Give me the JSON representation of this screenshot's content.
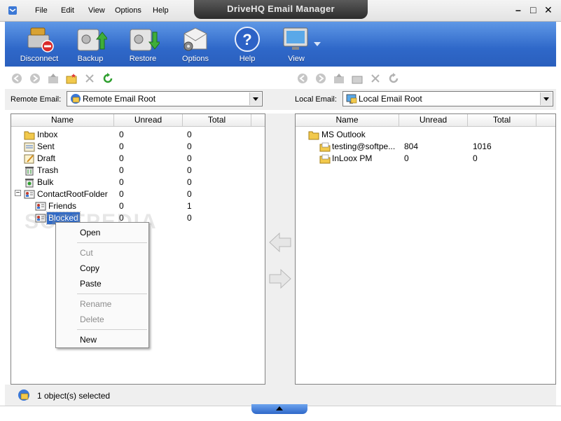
{
  "app": {
    "title": "DriveHQ Email Manager"
  },
  "menu": [
    {
      "label": "File"
    },
    {
      "label": "Edit"
    },
    {
      "label": "View"
    },
    {
      "label": "Options"
    },
    {
      "label": "Help"
    }
  ],
  "window_controls": {
    "minimize": "–",
    "restore": "□",
    "close": "✕"
  },
  "toolbar": {
    "disconnect": "Disconnect",
    "backup": "Backup",
    "restore": "Restore",
    "options": "Options",
    "help": "Help",
    "view": "View"
  },
  "remote": {
    "label": "Remote Email:",
    "selected": "Remote Email Root",
    "columns": [
      "Name",
      "Unread",
      "Total"
    ],
    "rows": [
      {
        "name": "Inbox",
        "unread": "0",
        "total": "0",
        "icon": "inbox-folder-icon"
      },
      {
        "name": "Sent",
        "unread": "0",
        "total": "0",
        "icon": "sent-folder-icon"
      },
      {
        "name": "Draft",
        "unread": "0",
        "total": "0",
        "icon": "draft-folder-icon"
      },
      {
        "name": "Trash",
        "unread": "0",
        "total": "0",
        "icon": "trash-icon"
      },
      {
        "name": "Bulk",
        "unread": "0",
        "total": "0",
        "icon": "bulk-icon"
      },
      {
        "name": "ContactRootFolder",
        "unread": "0",
        "total": "0",
        "icon": "contact-card-icon",
        "expander": "−"
      },
      {
        "name": "Friends",
        "unread": "0",
        "total": "1",
        "icon": "contact-card-icon"
      },
      {
        "name": "Blocked",
        "unread": "0",
        "total": "0",
        "icon": "contact-card-icon",
        "selected": true
      }
    ]
  },
  "local": {
    "label": "Local Email:",
    "selected": "Local Email Root",
    "columns": [
      "Name",
      "Unread",
      "Total"
    ],
    "rows": [
      {
        "name": "MS Outlook",
        "unread": "",
        "total": "",
        "icon": "folder-icon"
      },
      {
        "name": "testing@softpe...",
        "unread": "804",
        "total": "1016",
        "icon": "mail-folder-icon"
      },
      {
        "name": "InLoox PM",
        "unread": "0",
        "total": "0",
        "icon": "mail-folder-icon"
      }
    ]
  },
  "context_menu": {
    "open": "Open",
    "cut": "Cut",
    "copy": "Copy",
    "paste": "Paste",
    "rename": "Rename",
    "delete": "Delete",
    "new": "New"
  },
  "status": {
    "text": "1 object(s) selected"
  },
  "colors": {
    "toolbar": "#2f68c9",
    "selection": "#316ac5"
  },
  "watermark": "SOFTPEDIA"
}
